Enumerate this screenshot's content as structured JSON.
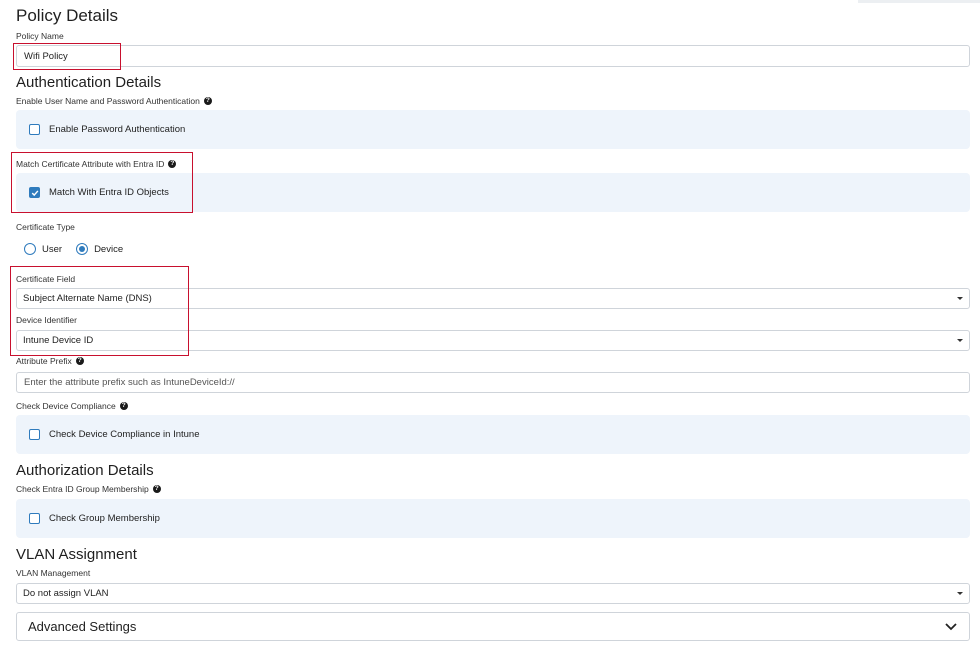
{
  "policy": {
    "title": "Policy Details",
    "name_label": "Policy Name",
    "name_value": "Wifi Policy"
  },
  "authentication": {
    "title": "Authentication Details",
    "password_auth_label": "Enable User Name and Password Authentication",
    "password_auth_checkbox": "Enable Password Authentication",
    "password_auth_checked": false,
    "match_cert_label": "Match Certificate Attribute with Entra ID",
    "match_cert_checkbox": "Match With Entra ID Objects",
    "match_cert_checked": true,
    "cert_type_label": "Certificate Type",
    "cert_type_options": [
      "User",
      "Device"
    ],
    "cert_type_selected": "Device",
    "cert_field_label": "Certificate Field",
    "cert_field_value": "Subject Alternate Name (DNS)",
    "device_identifier_label": "Device Identifier",
    "device_identifier_value": "Intune Device ID",
    "attribute_prefix_label": "Attribute Prefix",
    "attribute_prefix_placeholder": "Enter the attribute prefix such as IntuneDeviceId://",
    "compliance_label": "Check Device Compliance",
    "compliance_checkbox": "Check Device Compliance in Intune",
    "compliance_checked": false
  },
  "authorization": {
    "title": "Authorization Details",
    "group_label": "Check Entra ID Group Membership",
    "group_checkbox": "Check Group Membership",
    "group_checked": false
  },
  "vlan": {
    "title": "VLAN Assignment",
    "management_label": "VLAN Management",
    "management_value": "Do not assign VLAN"
  },
  "advanced": {
    "title": "Advanced Settings"
  },
  "icons": {
    "help": "question-circle-icon",
    "dropdown": "caret-down-icon",
    "expand": "chevron-down-icon",
    "checkmark": "checkmark-icon"
  },
  "colors": {
    "accent": "#2f7bbd",
    "panel_bg": "#eef4fb",
    "highlight_box": "#c8102e"
  }
}
